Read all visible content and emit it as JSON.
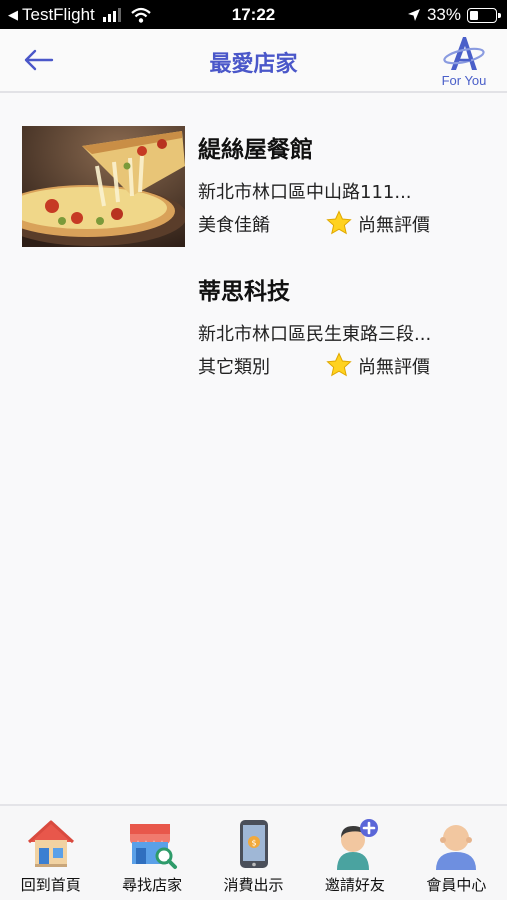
{
  "status_bar": {
    "back_app": "TestFlight",
    "time": "17:22",
    "battery": "33%",
    "battery_level": 0.33
  },
  "header": {
    "title": "最愛店家",
    "logo_text": "For You"
  },
  "stores": [
    {
      "name": "緹絲屋餐館",
      "address": "新北市林口區中山路111...",
      "category": "美食佳餚",
      "rating": "尚無評價",
      "thumbnail_icon": "pizza-photo"
    },
    {
      "name": "蒂思科技",
      "address": "新北市林口區民生東路三段...",
      "category": "其它類別",
      "rating": "尚無評價",
      "thumbnail_icon": ""
    }
  ],
  "tabs": [
    {
      "label": "回到首頁",
      "icon": "home-icon"
    },
    {
      "label": "尋找店家",
      "icon": "store-search-icon"
    },
    {
      "label": "消費出示",
      "icon": "phone-payment-icon"
    },
    {
      "label": "邀請好友",
      "icon": "invite-friend-icon"
    },
    {
      "label": "會員中心",
      "icon": "member-icon"
    }
  ],
  "colors": {
    "accent": "#4a57c9",
    "star": "#ffd21f",
    "background": "#f9f9fa"
  }
}
